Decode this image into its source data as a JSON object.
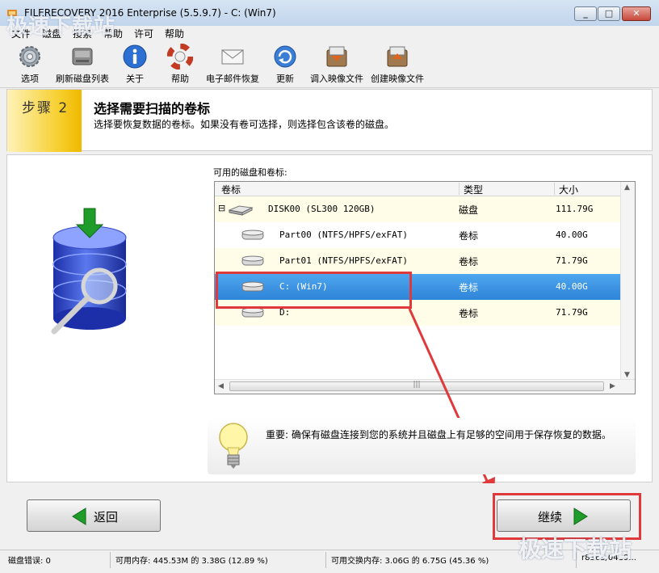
{
  "window": {
    "title": "FILERECOVERY 2016 Enterprise (5.5.9.7) - C: (Win7)",
    "min_glyph": "_",
    "max_glyph": "□",
    "close_glyph": "✕"
  },
  "watermark": {
    "top": "极速下载站",
    "bottom": "极速下载站"
  },
  "menu": [
    "文件",
    "磁盘",
    "搜索",
    "帮助",
    "许可",
    "帮助"
  ],
  "toolbar": [
    {
      "label": "选项",
      "icon": "gear-icon"
    },
    {
      "label": "刷新磁盘列表",
      "icon": "refresh-disk-icon"
    },
    {
      "label": "关于",
      "icon": "info-icon"
    },
    {
      "label": "帮助",
      "icon": "lifebuoy-icon"
    },
    {
      "label": "电子邮件恢复",
      "icon": "envelope-icon"
    },
    {
      "label": "更新",
      "icon": "update-icon"
    },
    {
      "label": "调入映像文件",
      "icon": "load-image-icon"
    },
    {
      "label": "创建映像文件",
      "icon": "create-image-icon"
    }
  ],
  "step": {
    "number": "步骤 2",
    "title": "选择需要扫描的卷标",
    "description": "选择要恢复数据的卷标。如果没有卷可选择，则选择包含该卷的磁盘。"
  },
  "volume_list": {
    "label": "可用的磁盘和卷标:",
    "columns": [
      "卷标",
      "类型",
      "大小"
    ],
    "rows": [
      {
        "name": "DISK00 (SL300 120GB)",
        "type": "磁盘",
        "size": "111.79G",
        "selected": false
      },
      {
        "name": "Part00 (NTFS/HPFS/exFAT)",
        "type": "卷标",
        "size": "40.00G",
        "selected": false
      },
      {
        "name": "Part01 (NTFS/HPFS/exFAT)",
        "type": "卷标",
        "size": "71.79G",
        "selected": false
      },
      {
        "name": "C: (Win7)",
        "type": "卷标",
        "size": "40.00G",
        "selected": true
      },
      {
        "name": "D:",
        "type": "卷标",
        "size": "71.79G",
        "selected": false
      }
    ],
    "expand_glyph": "⊟",
    "scroll_up": "▲",
    "scroll_down": "▼",
    "scroll_left": "◀",
    "scroll_right": "▶",
    "scroll_grip": "|||"
  },
  "notice": "重要: 确保有磁盘连接到您的系统并且磁盘上有足够的空间用于保存恢复的数据。",
  "buttons": {
    "back": "返回",
    "continue": "继续"
  },
  "status": {
    "disk_errors": "磁盘错误: 0",
    "available_memory": "可用内存: 445.53M 的 3.38G (12.89 %)",
    "available_swap": "可用交换内存: 3.06G 的 6.75G (45.36 %)",
    "version": "r8363/0419..."
  },
  "colors": {
    "selection": "#2f84d8",
    "highlight_box": "#e0393b",
    "arrow_green": "#1f9c2a",
    "step_badge": "#f6cf2d"
  }
}
